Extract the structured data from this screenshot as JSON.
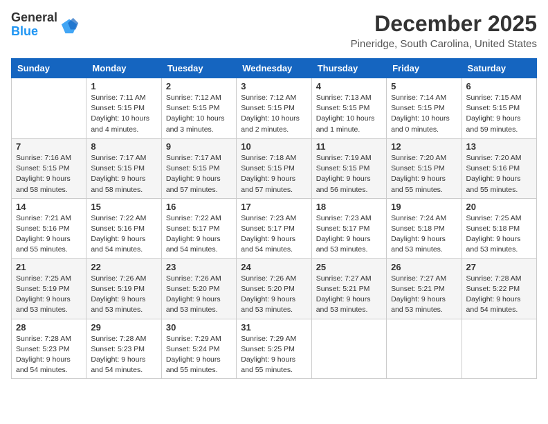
{
  "logo": {
    "line1": "General",
    "line2": "Blue"
  },
  "header": {
    "month": "December 2025",
    "location": "Pineridge, South Carolina, United States"
  },
  "days_of_week": [
    "Sunday",
    "Monday",
    "Tuesday",
    "Wednesday",
    "Thursday",
    "Friday",
    "Saturday"
  ],
  "weeks": [
    [
      {
        "day": "",
        "info": ""
      },
      {
        "day": "1",
        "info": "Sunrise: 7:11 AM\nSunset: 5:15 PM\nDaylight: 10 hours\nand 4 minutes."
      },
      {
        "day": "2",
        "info": "Sunrise: 7:12 AM\nSunset: 5:15 PM\nDaylight: 10 hours\nand 3 minutes."
      },
      {
        "day": "3",
        "info": "Sunrise: 7:12 AM\nSunset: 5:15 PM\nDaylight: 10 hours\nand 2 minutes."
      },
      {
        "day": "4",
        "info": "Sunrise: 7:13 AM\nSunset: 5:15 PM\nDaylight: 10 hours\nand 1 minute."
      },
      {
        "day": "5",
        "info": "Sunrise: 7:14 AM\nSunset: 5:15 PM\nDaylight: 10 hours\nand 0 minutes."
      },
      {
        "day": "6",
        "info": "Sunrise: 7:15 AM\nSunset: 5:15 PM\nDaylight: 9 hours\nand 59 minutes."
      }
    ],
    [
      {
        "day": "7",
        "info": "Sunrise: 7:16 AM\nSunset: 5:15 PM\nDaylight: 9 hours\nand 58 minutes."
      },
      {
        "day": "8",
        "info": "Sunrise: 7:17 AM\nSunset: 5:15 PM\nDaylight: 9 hours\nand 58 minutes."
      },
      {
        "day": "9",
        "info": "Sunrise: 7:17 AM\nSunset: 5:15 PM\nDaylight: 9 hours\nand 57 minutes."
      },
      {
        "day": "10",
        "info": "Sunrise: 7:18 AM\nSunset: 5:15 PM\nDaylight: 9 hours\nand 57 minutes."
      },
      {
        "day": "11",
        "info": "Sunrise: 7:19 AM\nSunset: 5:15 PM\nDaylight: 9 hours\nand 56 minutes."
      },
      {
        "day": "12",
        "info": "Sunrise: 7:20 AM\nSunset: 5:15 PM\nDaylight: 9 hours\nand 55 minutes."
      },
      {
        "day": "13",
        "info": "Sunrise: 7:20 AM\nSunset: 5:16 PM\nDaylight: 9 hours\nand 55 minutes."
      }
    ],
    [
      {
        "day": "14",
        "info": "Sunrise: 7:21 AM\nSunset: 5:16 PM\nDaylight: 9 hours\nand 55 minutes."
      },
      {
        "day": "15",
        "info": "Sunrise: 7:22 AM\nSunset: 5:16 PM\nDaylight: 9 hours\nand 54 minutes."
      },
      {
        "day": "16",
        "info": "Sunrise: 7:22 AM\nSunset: 5:17 PM\nDaylight: 9 hours\nand 54 minutes."
      },
      {
        "day": "17",
        "info": "Sunrise: 7:23 AM\nSunset: 5:17 PM\nDaylight: 9 hours\nand 54 minutes."
      },
      {
        "day": "18",
        "info": "Sunrise: 7:23 AM\nSunset: 5:17 PM\nDaylight: 9 hours\nand 53 minutes."
      },
      {
        "day": "19",
        "info": "Sunrise: 7:24 AM\nSunset: 5:18 PM\nDaylight: 9 hours\nand 53 minutes."
      },
      {
        "day": "20",
        "info": "Sunrise: 7:25 AM\nSunset: 5:18 PM\nDaylight: 9 hours\nand 53 minutes."
      }
    ],
    [
      {
        "day": "21",
        "info": "Sunrise: 7:25 AM\nSunset: 5:19 PM\nDaylight: 9 hours\nand 53 minutes."
      },
      {
        "day": "22",
        "info": "Sunrise: 7:26 AM\nSunset: 5:19 PM\nDaylight: 9 hours\nand 53 minutes."
      },
      {
        "day": "23",
        "info": "Sunrise: 7:26 AM\nSunset: 5:20 PM\nDaylight: 9 hours\nand 53 minutes."
      },
      {
        "day": "24",
        "info": "Sunrise: 7:26 AM\nSunset: 5:20 PM\nDaylight: 9 hours\nand 53 minutes."
      },
      {
        "day": "25",
        "info": "Sunrise: 7:27 AM\nSunset: 5:21 PM\nDaylight: 9 hours\nand 53 minutes."
      },
      {
        "day": "26",
        "info": "Sunrise: 7:27 AM\nSunset: 5:21 PM\nDaylight: 9 hours\nand 53 minutes."
      },
      {
        "day": "27",
        "info": "Sunrise: 7:28 AM\nSunset: 5:22 PM\nDaylight: 9 hours\nand 54 minutes."
      }
    ],
    [
      {
        "day": "28",
        "info": "Sunrise: 7:28 AM\nSunset: 5:23 PM\nDaylight: 9 hours\nand 54 minutes."
      },
      {
        "day": "29",
        "info": "Sunrise: 7:28 AM\nSunset: 5:23 PM\nDaylight: 9 hours\nand 54 minutes."
      },
      {
        "day": "30",
        "info": "Sunrise: 7:29 AM\nSunset: 5:24 PM\nDaylight: 9 hours\nand 55 minutes."
      },
      {
        "day": "31",
        "info": "Sunrise: 7:29 AM\nSunset: 5:25 PM\nDaylight: 9 hours\nand 55 minutes."
      },
      {
        "day": "",
        "info": ""
      },
      {
        "day": "",
        "info": ""
      },
      {
        "day": "",
        "info": ""
      }
    ]
  ]
}
